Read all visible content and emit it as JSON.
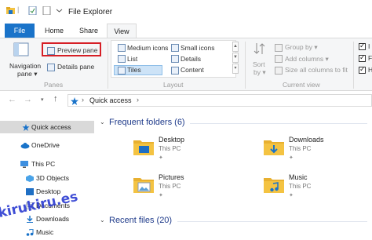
{
  "window": {
    "title": "File Explorer"
  },
  "tabs": [
    {
      "label": "File"
    },
    {
      "label": "Home"
    },
    {
      "label": "Share"
    },
    {
      "label": "View"
    }
  ],
  "ribbon": {
    "navigation_pane": {
      "line1": "Navigation",
      "line2": "pane ▾"
    },
    "preview_pane": "Preview pane",
    "details_pane": "Details pane",
    "panes_group": "Panes",
    "layout": {
      "medium_icons": "Medium icons",
      "small_icons": "Small icons",
      "list": "List",
      "details": "Details",
      "tiles": "Tiles",
      "content": "Content",
      "group": "Layout"
    },
    "sort_by": {
      "line1": "Sort",
      "line2": "by ▾"
    },
    "group_by": "Group by ▾",
    "add_columns": "Add columns ▾",
    "size_all_columns": "Size all columns to fit",
    "current_view_group": "Current view",
    "check_prefix": [
      "I",
      "F",
      "H"
    ]
  },
  "address": {
    "path_root": "Quick access",
    "separator": "›"
  },
  "nav": {
    "quick_access": "Quick access",
    "onedrive": "OneDrive",
    "this_pc": "This PC",
    "children": [
      "3D Objects",
      "Desktop",
      "Documents",
      "Downloads",
      "Music"
    ]
  },
  "content": {
    "frequent_title": "Frequent folders (6)",
    "folders": [
      {
        "name": "Desktop",
        "location": "This PC"
      },
      {
        "name": "Downloads",
        "location": "This PC"
      },
      {
        "name": "Pictures",
        "location": "This PC"
      },
      {
        "name": "Music",
        "location": "This PC"
      }
    ],
    "recent_title": "Recent files (20)"
  },
  "watermark": "kirukiru.es",
  "colors": {
    "accent": "#1a73c9",
    "highlight": "#d61f26",
    "folder": "#f4c342",
    "group_title": "#1e3a8a"
  }
}
